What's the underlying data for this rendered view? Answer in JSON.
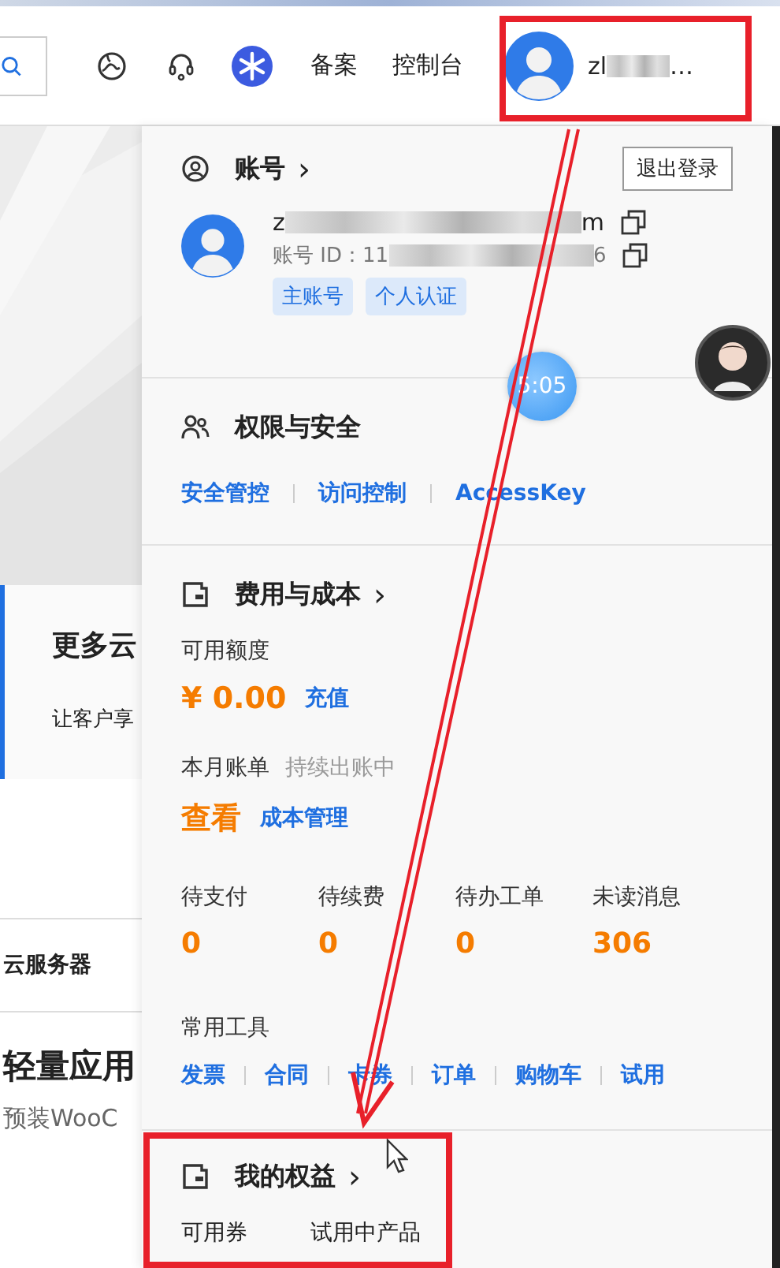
{
  "header": {
    "nav_links": [
      "备案",
      "控制台"
    ],
    "user": {
      "name_start": "zl",
      "ellipsis": "…"
    }
  },
  "background_page": {
    "promo_title": "更多云",
    "promo_text": "让客户享",
    "tab_label": "云服务器",
    "product_title": "轻量应用",
    "product_text": "预装WooC"
  },
  "account": {
    "title": "账号",
    "chevron": "›",
    "logout": "退出登录",
    "email_start": "z",
    "email_end": "m",
    "id_label": "账号 ID：11",
    "id_end": "6",
    "tags": [
      "主账号",
      "个人认证"
    ]
  },
  "security": {
    "title": "权限与安全",
    "links": [
      "安全管控",
      "访问控制",
      "AccessKey"
    ]
  },
  "billing": {
    "title": "费用与成本",
    "chevron": "›",
    "credit_label": "可用额度",
    "credit_value": "¥ 0.00",
    "recharge": "充值",
    "bill_label": "本月账单",
    "bill_status": "持续出账中",
    "view": "查看",
    "cost_link": "成本管理",
    "stats": [
      {
        "label": "待支付",
        "value": "0"
      },
      {
        "label": "待续费",
        "value": "0"
      },
      {
        "label": "待办工单",
        "value": "0"
      },
      {
        "label": "未读消息",
        "value": "306"
      }
    ],
    "tools_label": "常用工具",
    "tools": [
      "发票",
      "合同",
      "卡券",
      "订单",
      "购物车",
      "试用"
    ]
  },
  "benefits": {
    "title": "我的权益",
    "chevron": "›",
    "items": [
      "可用券",
      "试用中产品"
    ]
  },
  "clock": {
    "time": "5:05"
  }
}
